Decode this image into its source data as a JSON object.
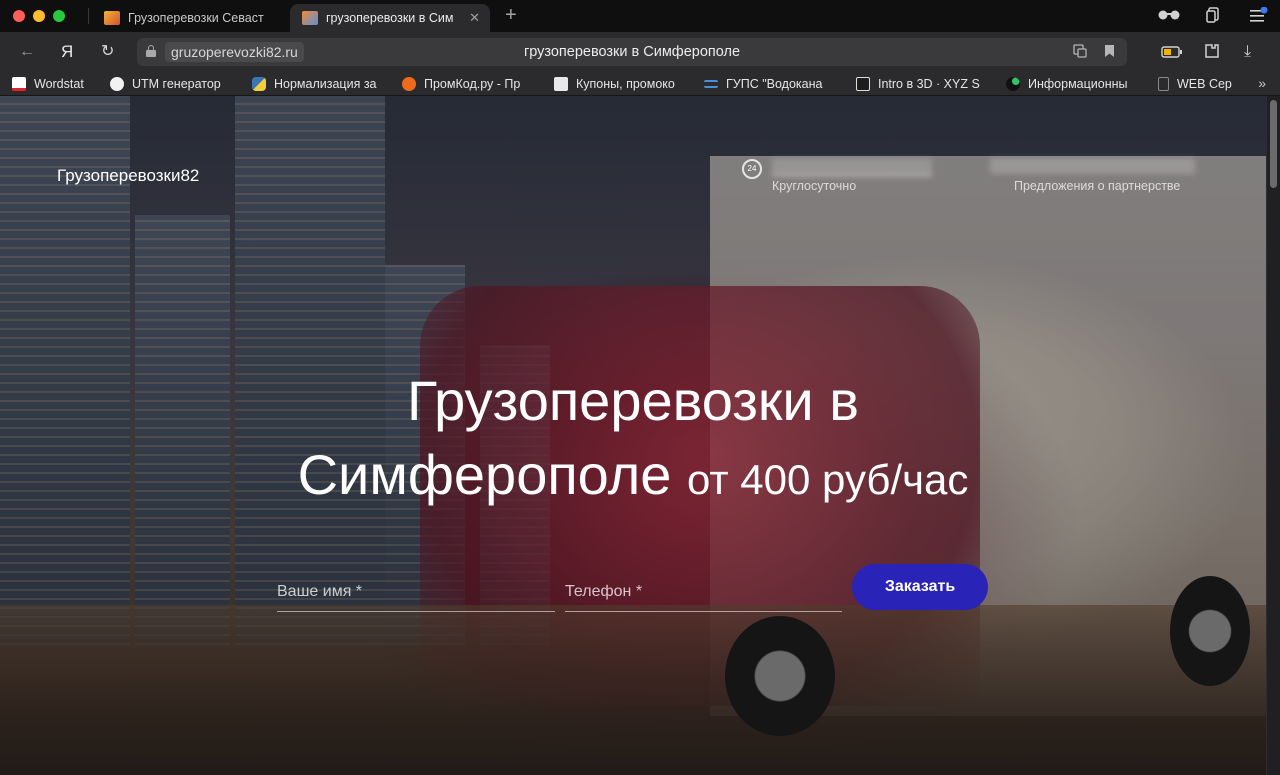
{
  "browser": {
    "tabs": [
      {
        "title": "Грузоперевозки Севаст",
        "active": false
      },
      {
        "title": "грузоперевозки в Сим",
        "active": true
      }
    ],
    "url_domain": "gruzoperevozki82.ru",
    "page_title": "грузоперевозки в Симферополе",
    "yandex_label": "Я"
  },
  "bookmarks": [
    {
      "label": "Wordstat",
      "icon": "wordstat-icon",
      "color": "#e0242b"
    },
    {
      "label": "UTM генератор",
      "icon": "utm-icon",
      "color": "#ffffff"
    },
    {
      "label": "Нормализация за",
      "icon": "python-icon",
      "color": "#3b77b0"
    },
    {
      "label": "ПромКод.ру - Пр",
      "icon": "promkod-icon",
      "color": "#f06a1c"
    },
    {
      "label": "Купоны, промоко",
      "icon": "document-icon",
      "color": "#e9e9eb"
    },
    {
      "label": "ГУПС \"Водокана",
      "icon": "water-icon",
      "color": "#4a8fd8"
    },
    {
      "label": "Intro в 3D · XYZ S",
      "icon": "xyz-icon",
      "color": "#dddddd"
    },
    {
      "label": "Информационны",
      "icon": "info-icon",
      "color": "#31c46b"
    },
    {
      "label": "WEB Cер",
      "icon": "page-icon",
      "color": "#8a8a8c"
    }
  ],
  "site": {
    "brand": "Грузоперевозки82",
    "hours_label": "Круглосуточно",
    "icon_24_label": "24",
    "partners_label": "Предложения о партнерстве",
    "hero_line1": "Грузоперевозки в",
    "hero_line2": "Симферополе",
    "hero_price": "от 400 руб/час",
    "form": {
      "name_placeholder": "Ваше имя *",
      "phone_placeholder": "Телефон *",
      "submit_label": "Заказать"
    },
    "accent_color": "#2a23b8"
  }
}
